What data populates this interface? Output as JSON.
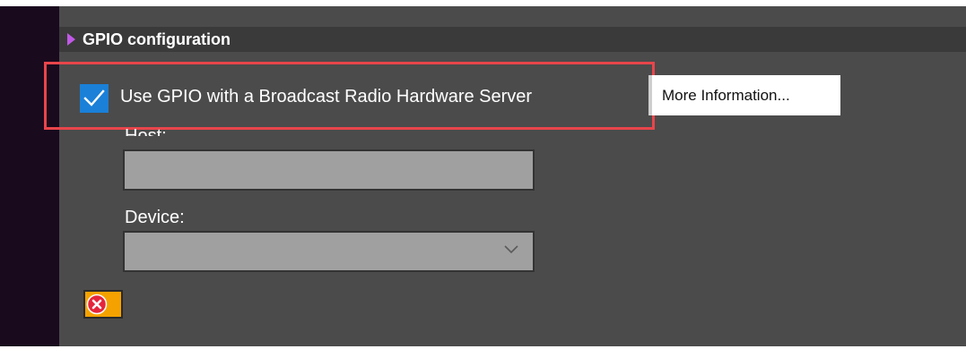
{
  "section": {
    "title": "GPIO configuration",
    "expanded_icon": "triangle-right-icon"
  },
  "gpio": {
    "checkbox_label": "Use GPIO with a Broadcast Radio Hardware Server",
    "checked": true,
    "more_info_label": "More Information..."
  },
  "host": {
    "label": "Host:",
    "value": ""
  },
  "device": {
    "label": "Device:",
    "value": "",
    "dropdown_icon": "chevron-down-icon"
  },
  "status": {
    "icon": "error-x-icon"
  },
  "colors": {
    "accent": "#1a80d8",
    "highlight": "#e8454b",
    "section_marker": "#c159e6",
    "error_background": "#f5a200",
    "error_icon": "#e5243b"
  }
}
